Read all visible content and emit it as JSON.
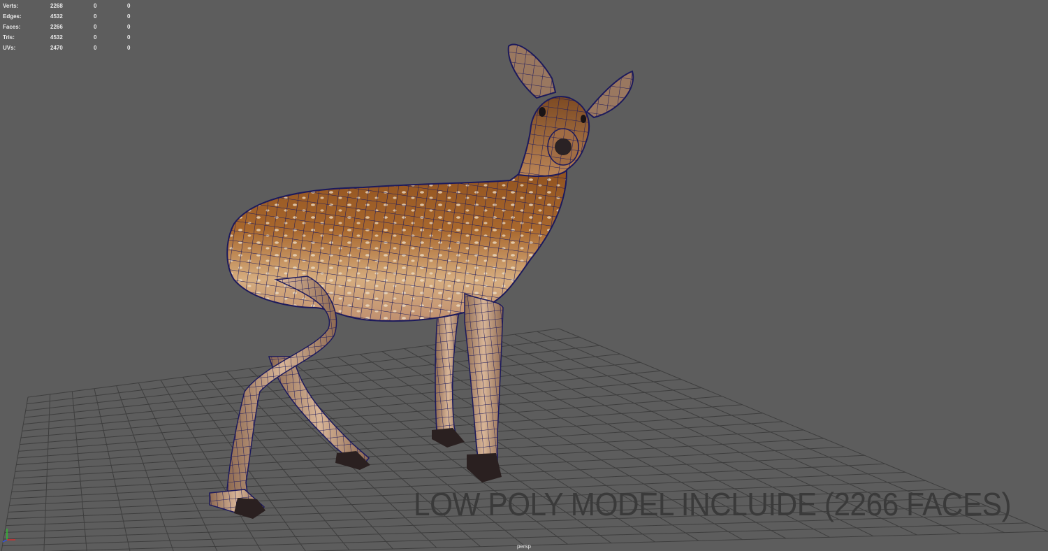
{
  "stats": {
    "rows": [
      {
        "label": "Verts:",
        "total": "2268",
        "selected": "0",
        "uv": "0"
      },
      {
        "label": "Edges:",
        "total": "4532",
        "selected": "0",
        "uv": "0"
      },
      {
        "label": "Faces:",
        "total": "2266",
        "selected": "0",
        "uv": "0"
      },
      {
        "label": "Tris:",
        "total": "4532",
        "selected": "0",
        "uv": "0"
      },
      {
        "label": "UVs:",
        "total": "2470",
        "selected": "0",
        "uv": "0"
      }
    ]
  },
  "viewport": {
    "camera": "persp",
    "watermark": "LOW POLY MODEL INCLUIDE (2266 FACES)",
    "background_color": "#5d5d5d",
    "grid_color": "#3e3e3e",
    "wireframe_color": "#1c1a5c"
  },
  "axis": {
    "x_color": "#d03030",
    "y_color": "#30c030",
    "z_color": "#3050e0"
  }
}
